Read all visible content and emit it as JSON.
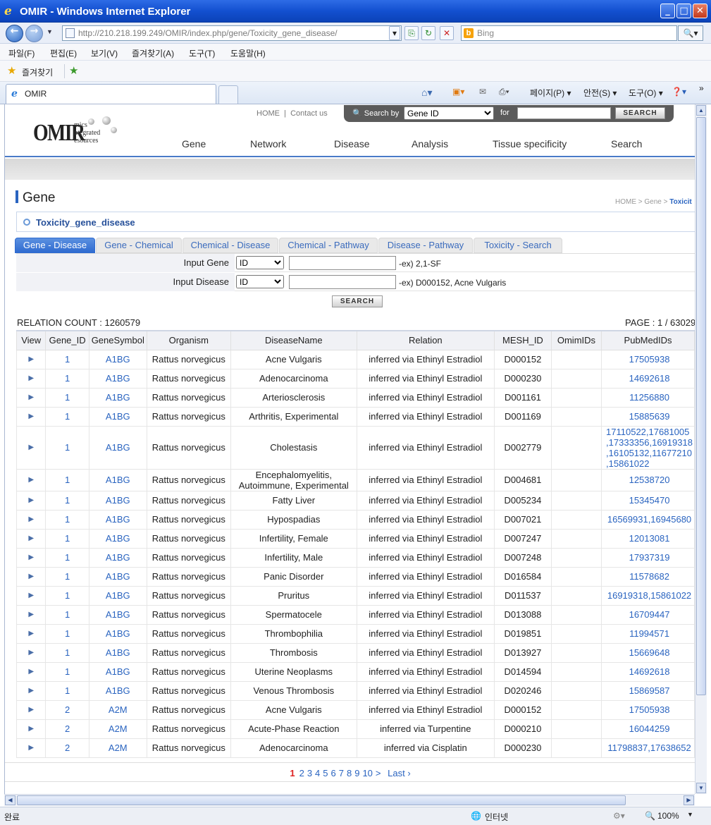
{
  "browser": {
    "title": "OMIR - Windows Internet Explorer",
    "url": "http://210.218.199.249/OMIR/index.php/gene/Toxicity_gene_disease/",
    "search_placeholder": "Bing",
    "menu": [
      "파일(F)",
      "편집(E)",
      "보기(V)",
      "즐겨찾기(A)",
      "도구(T)",
      "도움말(H)"
    ],
    "favorites_label": "즐겨찾기",
    "tab_title": "OMIR",
    "commands": [
      "페이지(P)",
      "안전(S)",
      "도구(O)"
    ],
    "status_left": "완료",
    "status_zone": "인터넷",
    "zoom": "100%"
  },
  "site": {
    "logo_big": "OMIR",
    "logo_small": [
      "mics",
      "ntegrated",
      "esources"
    ],
    "home_link": "HOME",
    "sep": "|",
    "contact_link": "Contact us",
    "search_by_label": "Search by",
    "search_by_value": "Gene ID",
    "for_label": "for",
    "search_button": "SEARCH",
    "nav": [
      "Gene",
      "Network",
      "Disease",
      "Analysis",
      "Tissue specificity",
      "Search"
    ]
  },
  "page": {
    "title": "Gene",
    "breadcrumb_prefix": "HOME > Gene > ",
    "breadcrumb_current": "Toxicit",
    "subtitle": "Toxicity_gene_disease",
    "tabs": [
      "Gene - Disease",
      "Gene - Chemical",
      "Chemical - Disease",
      "Chemical - Pathway",
      "Disease - Pathway",
      "Toxicity - Search"
    ],
    "form": {
      "gene_label": "Input Gene",
      "gene_type": "ID",
      "gene_example": "-ex) 2,1-SF",
      "disease_label": "Input Disease",
      "disease_type": "ID",
      "disease_example": "-ex) D000152, Acne Vulgaris",
      "search_button": "SEARCH"
    },
    "relation_count": "RELATION COUNT : 1260579",
    "page_info": "PAGE : 1 / 63029"
  },
  "table": {
    "columns": [
      "View",
      "Gene_ID",
      "GeneSymbol",
      "Organism",
      "DiseaseName",
      "Relation",
      "MESH_ID",
      "OmimIDs",
      "PubMedIDs"
    ],
    "rows": [
      {
        "gene_id": "1",
        "symbol": "A1BG",
        "organism": "Rattus norvegicus",
        "disease": "Acne Vulgaris",
        "relation": "inferred via Ethinyl Estradiol",
        "mesh": "D000152",
        "omim": "",
        "pubmed": [
          "17505938"
        ]
      },
      {
        "gene_id": "1",
        "symbol": "A1BG",
        "organism": "Rattus norvegicus",
        "disease": "Adenocarcinoma",
        "relation": "inferred via Ethinyl Estradiol",
        "mesh": "D000230",
        "omim": "",
        "pubmed": [
          "14692618"
        ]
      },
      {
        "gene_id": "1",
        "symbol": "A1BG",
        "organism": "Rattus norvegicus",
        "disease": "Arteriosclerosis",
        "relation": "inferred via Ethinyl Estradiol",
        "mesh": "D001161",
        "omim": "",
        "pubmed": [
          "11256880"
        ]
      },
      {
        "gene_id": "1",
        "symbol": "A1BG",
        "organism": "Rattus norvegicus",
        "disease": "Arthritis, Experimental",
        "relation": "inferred via Ethinyl Estradiol",
        "mesh": "D001169",
        "omim": "",
        "pubmed": [
          "15885639"
        ]
      },
      {
        "gene_id": "1",
        "symbol": "A1BG",
        "organism": "Rattus norvegicus",
        "disease": "Cholestasis",
        "relation": "inferred via Ethinyl Estradiol",
        "mesh": "D002779",
        "omim": "",
        "pubmed": [
          "17110522,17681005",
          ",17333356,16919318",
          ",16105132,11677210",
          ",15861022"
        ]
      },
      {
        "gene_id": "1",
        "symbol": "A1BG",
        "organism": "Rattus norvegicus",
        "disease": "Encephalomyelitis, Autoimmune, Experimental",
        "relation": "inferred via Ethinyl Estradiol",
        "mesh": "D004681",
        "omim": "",
        "pubmed": [
          "12538720"
        ]
      },
      {
        "gene_id": "1",
        "symbol": "A1BG",
        "organism": "Rattus norvegicus",
        "disease": "Fatty Liver",
        "relation": "inferred via Ethinyl Estradiol",
        "mesh": "D005234",
        "omim": "",
        "pubmed": [
          "15345470"
        ]
      },
      {
        "gene_id": "1",
        "symbol": "A1BG",
        "organism": "Rattus norvegicus",
        "disease": "Hypospadias",
        "relation": "inferred via Ethinyl Estradiol",
        "mesh": "D007021",
        "omim": "",
        "pubmed": [
          "16569931,16945680"
        ]
      },
      {
        "gene_id": "1",
        "symbol": "A1BG",
        "organism": "Rattus norvegicus",
        "disease": "Infertility, Female",
        "relation": "inferred via Ethinyl Estradiol",
        "mesh": "D007247",
        "omim": "",
        "pubmed": [
          "12013081"
        ]
      },
      {
        "gene_id": "1",
        "symbol": "A1BG",
        "organism": "Rattus norvegicus",
        "disease": "Infertility, Male",
        "relation": "inferred via Ethinyl Estradiol",
        "mesh": "D007248",
        "omim": "",
        "pubmed": [
          "17937319"
        ]
      },
      {
        "gene_id": "1",
        "symbol": "A1BG",
        "organism": "Rattus norvegicus",
        "disease": "Panic Disorder",
        "relation": "inferred via Ethinyl Estradiol",
        "mesh": "D016584",
        "omim": "",
        "pubmed": [
          "11578682"
        ]
      },
      {
        "gene_id": "1",
        "symbol": "A1BG",
        "organism": "Rattus norvegicus",
        "disease": "Pruritus",
        "relation": "inferred via Ethinyl Estradiol",
        "mesh": "D011537",
        "omim": "",
        "pubmed": [
          "16919318,15861022"
        ]
      },
      {
        "gene_id": "1",
        "symbol": "A1BG",
        "organism": "Rattus norvegicus",
        "disease": "Spermatocele",
        "relation": "inferred via Ethinyl Estradiol",
        "mesh": "D013088",
        "omim": "",
        "pubmed": [
          "16709447"
        ]
      },
      {
        "gene_id": "1",
        "symbol": "A1BG",
        "organism": "Rattus norvegicus",
        "disease": "Thrombophilia",
        "relation": "inferred via Ethinyl Estradiol",
        "mesh": "D019851",
        "omim": "",
        "pubmed": [
          "11994571"
        ]
      },
      {
        "gene_id": "1",
        "symbol": "A1BG",
        "organism": "Rattus norvegicus",
        "disease": "Thrombosis",
        "relation": "inferred via Ethinyl Estradiol",
        "mesh": "D013927",
        "omim": "",
        "pubmed": [
          "15669648"
        ]
      },
      {
        "gene_id": "1",
        "symbol": "A1BG",
        "organism": "Rattus norvegicus",
        "disease": "Uterine Neoplasms",
        "relation": "inferred via Ethinyl Estradiol",
        "mesh": "D014594",
        "omim": "",
        "pubmed": [
          "14692618"
        ]
      },
      {
        "gene_id": "1",
        "symbol": "A1BG",
        "organism": "Rattus norvegicus",
        "disease": "Venous Thrombosis",
        "relation": "inferred via Ethinyl Estradiol",
        "mesh": "D020246",
        "omim": "",
        "pubmed": [
          "15869587"
        ]
      },
      {
        "gene_id": "2",
        "symbol": "A2M",
        "organism": "Rattus norvegicus",
        "disease": "Acne Vulgaris",
        "relation": "inferred via Ethinyl Estradiol",
        "mesh": "D000152",
        "omim": "",
        "pubmed": [
          "17505938"
        ]
      },
      {
        "gene_id": "2",
        "symbol": "A2M",
        "organism": "Rattus norvegicus",
        "disease": "Acute-Phase Reaction",
        "relation": "inferred via Turpentine",
        "mesh": "D000210",
        "omim": "",
        "pubmed": [
          "16044259"
        ]
      },
      {
        "gene_id": "2",
        "symbol": "A2M",
        "organism": "Rattus norvegicus",
        "disease": "Adenocarcinoma",
        "relation": "inferred via Cisplatin",
        "mesh": "D000230",
        "omim": "",
        "pubmed": [
          "11798837,17638652"
        ]
      }
    ]
  },
  "pager": {
    "current": "1",
    "pages": [
      "2",
      "3",
      "4",
      "5",
      "6",
      "7",
      "8",
      "9",
      "10",
      ">"
    ],
    "last": "Last ›"
  }
}
